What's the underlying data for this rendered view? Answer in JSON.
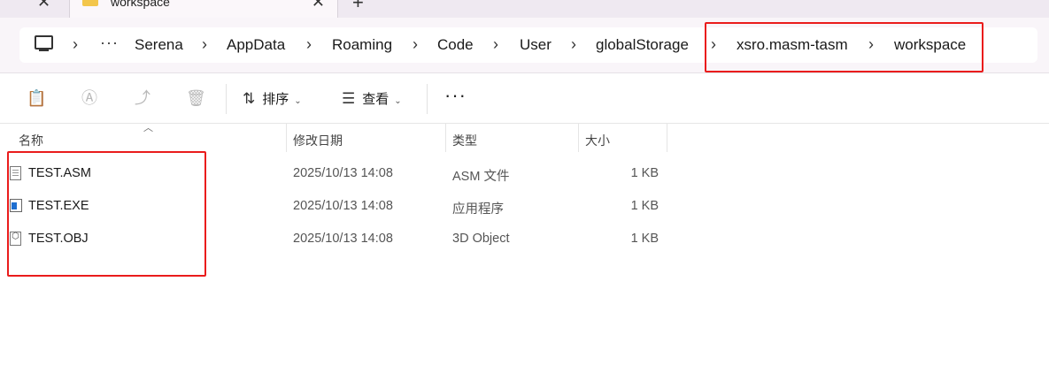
{
  "tabs": {
    "active_title": "workspace"
  },
  "breadcrumb": {
    "overflow": "···",
    "items": [
      "Serena",
      "AppData",
      "Roaming",
      "Code",
      "User",
      "globalStorage",
      "xsro.masm-tasm",
      "workspace"
    ]
  },
  "toolbar": {
    "sort_label": "排序",
    "view_label": "查看",
    "more": "···"
  },
  "columns": {
    "name": "名称",
    "date": "修改日期",
    "type": "类型",
    "size": "大小"
  },
  "files": [
    {
      "name": "TEST.ASM",
      "date": "2025/10/13 14:08",
      "type": "ASM 文件",
      "size": "1 KB",
      "icon": "text-file-icon"
    },
    {
      "name": "TEST.EXE",
      "date": "2025/10/13 14:08",
      "type": "应用程序",
      "size": "1 KB",
      "icon": "application-file-icon"
    },
    {
      "name": "TEST.OBJ",
      "date": "2025/10/13 14:08",
      "type": "3D Object",
      "size": "1 KB",
      "icon": "3d-object-file-icon"
    }
  ],
  "colors": {
    "highlight_box": "#ea1c1c",
    "tabstrip_bg": "#efe9f1",
    "folder_icon": "#f3c64b"
  }
}
